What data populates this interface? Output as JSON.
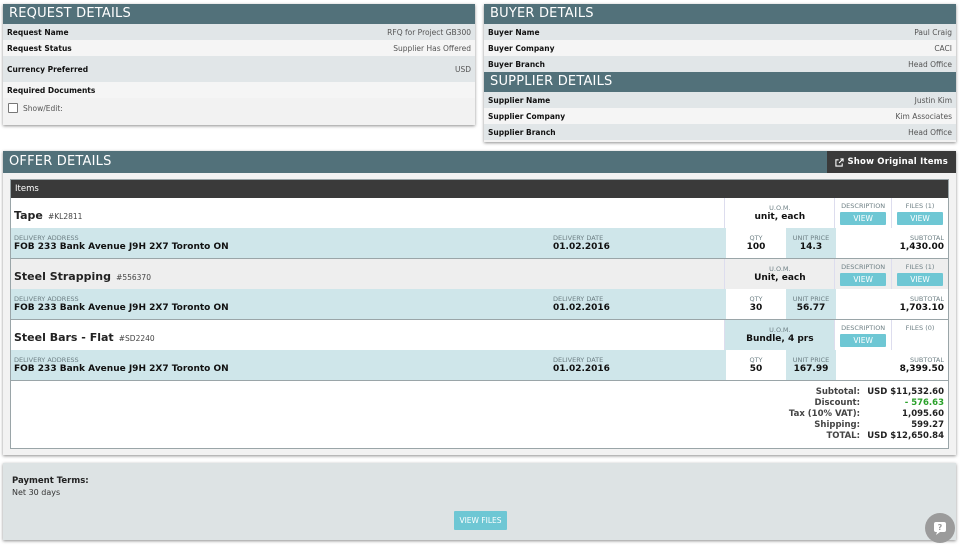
{
  "request": {
    "title": "REQUEST DETAILS",
    "rows": [
      {
        "k": "Request Name",
        "v": "RFQ for Project GB300"
      },
      {
        "k": "Request Status",
        "v": "Supplier Has Offered"
      },
      {
        "k": "Currency Preferred",
        "v": "USD"
      }
    ],
    "required_docs": "Required Documents",
    "show_edit": "Show/Edit:"
  },
  "buyer": {
    "title": "BUYER DETAILS",
    "rows": [
      {
        "k": "Buyer Name",
        "v": "Paul Craig"
      },
      {
        "k": "Buyer Company",
        "v": "CACI"
      },
      {
        "k": "Buyer Branch",
        "v": "Head Office"
      }
    ]
  },
  "supplier": {
    "title": "SUPPLIER DETAILS",
    "rows": [
      {
        "k": "Supplier Name",
        "v": "Justin Kim"
      },
      {
        "k": "Supplier Company",
        "v": "Kim Associates"
      },
      {
        "k": "Supplier Branch",
        "v": "Head Office"
      }
    ]
  },
  "offer": {
    "title": "OFFER DETAILS",
    "show_original": "Show Original Items",
    "items_header": "Items",
    "labels": {
      "uom": "U.O.M.",
      "description": "DESCRIPTION",
      "delivery_address": "DELIVERY ADDRESS",
      "delivery_date": "DELIVERY DATE",
      "qty": "QTY",
      "unit_price": "UNIT PRICE",
      "subtotal": "SUBTOTAL",
      "view": "VIEW"
    },
    "items": [
      {
        "name": "Tape",
        "code": "#KL2811",
        "uom": "unit, each",
        "files": "FILES (1)",
        "address": "FOB 233 Bank Avenue J9H 2X7 Toronto ON",
        "date": "01.02.2016",
        "qty": "100",
        "unit_price": "14.3",
        "subtotal": "1,430.00"
      },
      {
        "name": "Steel Strapping",
        "code": "#556370",
        "uom": "Unit, each",
        "files": "FILES (1)",
        "address": "FOB 233 Bank Avenue J9H 2X7 Toronto ON",
        "date": "01.02.2016",
        "qty": "30",
        "unit_price": "56.77",
        "subtotal": "1,703.10"
      },
      {
        "name": "Steel Bars - Flat",
        "code": "#SD2240",
        "uom": "Bundle, 4 prs",
        "files": "FILES (0)",
        "address": "FOB 233 Bank Avenue J9H 2X7 Toronto ON",
        "date": "01.02.2016",
        "qty": "50",
        "unit_price": "167.99",
        "subtotal": "8,399.50"
      }
    ],
    "totals": {
      "subtotal_label": "Subtotal:",
      "subtotal": "USD $11,532.60",
      "discount_label": "Discount:",
      "discount": "- 576.63",
      "tax_label": "Tax (10% VAT):",
      "tax": "1,095.60",
      "shipping_label": "Shipping:",
      "shipping": "599.27",
      "total_label": "TOTAL:",
      "total": "USD $12,650.84"
    },
    "discount_color": "#2aa12a"
  },
  "payment": {
    "label": "Payment Terms:",
    "value": "Net 30 days",
    "view_files": "VIEW FILES"
  },
  "help_icon": "help-chat-icon"
}
